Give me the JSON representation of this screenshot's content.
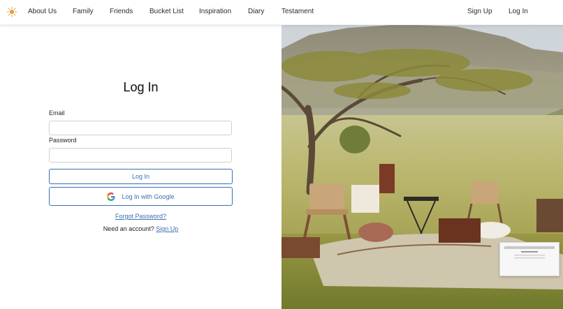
{
  "nav": {
    "logo_icon": "sun-icon",
    "links": [
      "About Us",
      "Family",
      "Friends",
      "Bucket List",
      "Inspiration",
      "Diary",
      "Testament"
    ],
    "sign_up": "Sign Up",
    "log_in": "Log In"
  },
  "login": {
    "title": "Log In",
    "email_label": "Email",
    "email_value": "",
    "password_label": "Password",
    "password_value": "",
    "submit_label": "Log In",
    "google_label": "Log In with Google",
    "google_icon": "google-icon",
    "forgot_label": "Forgot Password?",
    "need_account_text": "Need an account?",
    "sign_up_link": "Sign Up"
  },
  "colors": {
    "accent": "#3b6fb2",
    "logo": "#e2a14a"
  }
}
